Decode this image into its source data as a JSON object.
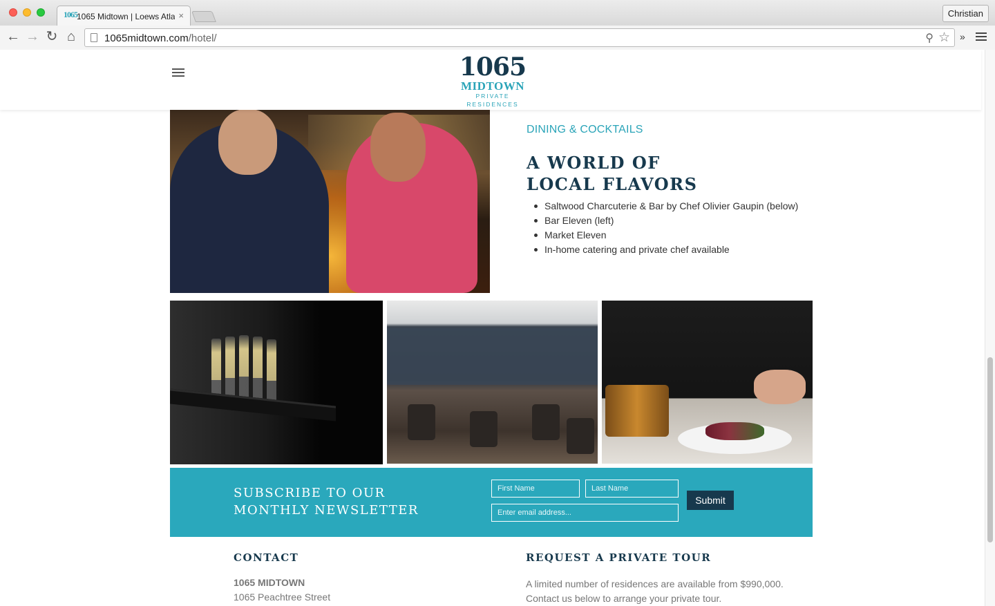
{
  "browser": {
    "tab_title": "1065 Midtown | Loews Atla",
    "tab_favicon": "1065",
    "tab_close": "×",
    "profile_name": "Christian",
    "url_host": "1065midtown.com",
    "url_path": "/hotel/",
    "extensions": "»",
    "back": "←",
    "forward": "→",
    "reload": "↻",
    "home": "⌂",
    "zoom": "⚲",
    "star": "☆"
  },
  "site": {
    "logo_number": "1065",
    "logo_name": "MIDTOWN",
    "logo_subtitle": "PRIVATE RESIDENCES"
  },
  "section": {
    "eyebrow": "DINING & COCKTAILS",
    "heading_line1": "A WORLD OF",
    "heading_line2": "LOCAL FLAVORS",
    "amenities": [
      "Saltwood Charcuterie & Bar by Chef Olivier Gaupin (below)",
      "Bar Eleven (left)",
      "Market Eleven",
      "In-home catering and private chef available"
    ]
  },
  "newsletter": {
    "heading_line1": "SUBSCRIBE TO OUR",
    "heading_line2": "MONTHLY NEWSLETTER",
    "first_name_placeholder": "First Name",
    "last_name_placeholder": "Last Name",
    "email_placeholder": "Enter email address...",
    "submit_label": "Submit"
  },
  "footer": {
    "contact_heading": "CONTACT",
    "contact_name": "1065 MIDTOWN",
    "contact_street": "1065 Peachtree Street",
    "tour_heading": "REQUEST A PRIVATE TOUR",
    "tour_line1": "A limited number of residences are available from $990,000.",
    "tour_line2": "Contact us below to arrange your private tour."
  },
  "icons": {
    "menu": "hamburger-icon",
    "browser_menu": "browser-menu-icon",
    "page": "page-icon"
  },
  "colors": {
    "brand_navy": "#17394d",
    "brand_teal": "#2aa4b8",
    "newsletter_bg": "#2aa8bc"
  }
}
